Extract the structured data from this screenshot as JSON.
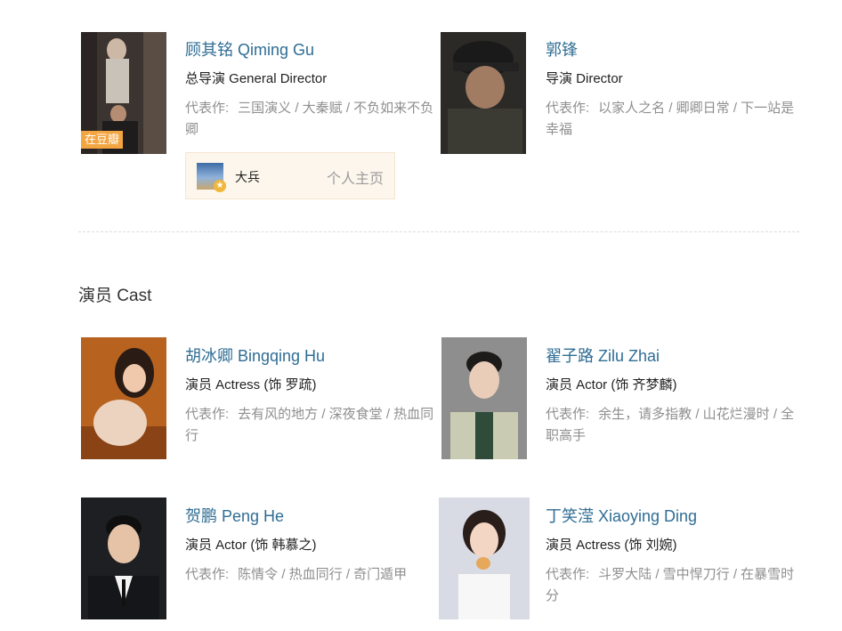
{
  "directors": [
    {
      "name": "顾其铭 Qiming Gu",
      "role": "总导演 General Director",
      "works_label": "代表作:",
      "works": "三国演义 / 大秦赋 / 不负如来不负卿",
      "badge": "在豆瓣",
      "personal": {
        "name": "大兵",
        "link": "个人主页"
      }
    },
    {
      "name": "郭锋",
      "role": "导演 Director",
      "works_label": "代表作:",
      "works": "以家人之名 / 卿卿日常 / 下一站是幸福"
    }
  ],
  "cast_title": "演员 Cast",
  "cast": [
    {
      "name": "胡冰卿 Bingqing Hu",
      "role": "演员 Actress (饰 罗疏)",
      "works_label": "代表作:",
      "works": "去有风的地方 / 深夜食堂 / 热血同行"
    },
    {
      "name": "翟子路 Zilu Zhai",
      "role": "演员 Actor (饰 齐梦麟)",
      "works_label": "代表作:",
      "works": "余生，请多指教 / 山花烂漫时 / 全职高手"
    },
    {
      "name": "贺鹏 Peng He",
      "role": "演员 Actor (饰 韩慕之)",
      "works_label": "代表作:",
      "works": "陈情令 / 热血同行 / 奇门遁甲"
    },
    {
      "name": "丁笑滢 Xiaoying Ding",
      "role": "演员 Actress (饰 刘婉)",
      "works_label": "代表作:",
      "works": "斗罗大陆 / 雪中悍刀行 / 在暴雪时分"
    }
  ]
}
